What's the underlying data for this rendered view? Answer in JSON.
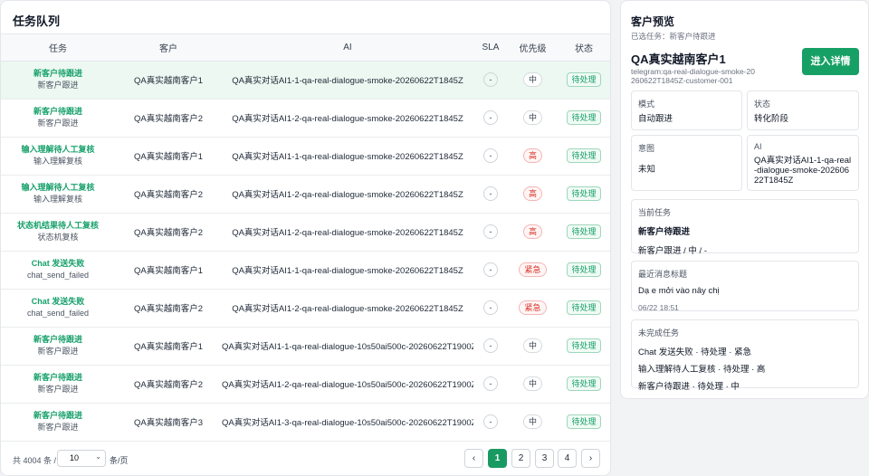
{
  "queue": {
    "title": "任务队列",
    "columns": [
      "任务",
      "客户",
      "AI",
      "SLA",
      "优先级",
      "状态"
    ],
    "rows": [
      {
        "task": "新客户待跟进",
        "sub": "新客户跟进",
        "customer": "QA真实越南客户1",
        "ai": "QA真实对话AI1-1-qa-real-dialogue-smoke-20260622T1845Z",
        "sla": "-",
        "priority": "中",
        "priority_level": "normal",
        "status": "待处理"
      },
      {
        "task": "新客户待跟进",
        "sub": "新客户跟进",
        "customer": "QA真实越南客户2",
        "ai": "QA真实对话AI1-2-qa-real-dialogue-smoke-20260622T1845Z",
        "sla": "-",
        "priority": "中",
        "priority_level": "normal",
        "status": "待处理"
      },
      {
        "task": "输入理解待人工复核",
        "sub": "输入理解复核",
        "customer": "QA真实越南客户1",
        "ai": "QA真实对话AI1-1-qa-real-dialogue-smoke-20260622T1845Z",
        "sla": "-",
        "priority": "高",
        "priority_level": "high",
        "status": "待处理"
      },
      {
        "task": "输入理解待人工复核",
        "sub": "输入理解复核",
        "customer": "QA真实越南客户2",
        "ai": "QA真实对话AI1-2-qa-real-dialogue-smoke-20260622T1845Z",
        "sla": "-",
        "priority": "高",
        "priority_level": "high",
        "status": "待处理"
      },
      {
        "task": "状态机结果待人工复核",
        "sub": "状态机复核",
        "customer": "QA真实越南客户2",
        "ai": "QA真实对话AI1-2-qa-real-dialogue-smoke-20260622T1845Z",
        "sla": "-",
        "priority": "高",
        "priority_level": "high",
        "status": "待处理"
      },
      {
        "task": "Chat 发送失败",
        "sub": "chat_send_failed",
        "customer": "QA真实越南客户1",
        "ai": "QA真实对话AI1-1-qa-real-dialogue-smoke-20260622T1845Z",
        "sla": "-",
        "priority": "紧急",
        "priority_level": "high",
        "status": "待处理"
      },
      {
        "task": "Chat 发送失败",
        "sub": "chat_send_failed",
        "customer": "QA真实越南客户2",
        "ai": "QA真实对话AI1-2-qa-real-dialogue-smoke-20260622T1845Z",
        "sla": "-",
        "priority": "紧急",
        "priority_level": "high",
        "status": "待处理"
      },
      {
        "task": "新客户待跟进",
        "sub": "新客户跟进",
        "customer": "QA真实越南客户1",
        "ai": "QA真实对话AI1-1-qa-real-dialogue-10s50ai500c-20260622T1900Z",
        "sla": "-",
        "priority": "中",
        "priority_level": "normal",
        "status": "待处理"
      },
      {
        "task": "新客户待跟进",
        "sub": "新客户跟进",
        "customer": "QA真实越南客户2",
        "ai": "QA真实对话AI1-2-qa-real-dialogue-10s50ai500c-20260622T1900Z",
        "sla": "-",
        "priority": "中",
        "priority_level": "normal",
        "status": "待处理"
      },
      {
        "task": "新客户待跟进",
        "sub": "新客户跟进",
        "customer": "QA真实越南客户3",
        "ai": "QA真实对话AI1-3-qa-real-dialogue-10s50ai500c-20260622T1900Z",
        "sla": "-",
        "priority": "中",
        "priority_level": "normal",
        "status": "待处理"
      }
    ]
  },
  "pager": {
    "total": "共 4004 条 /",
    "page_size": "10",
    "per_page_label": "条/页",
    "prev": "‹",
    "next": "›",
    "pages": [
      "1",
      "2",
      "3",
      "4"
    ],
    "current": "1"
  },
  "preview": {
    "title": "客户预览",
    "selected": "已选任务：新客户待跟进",
    "name": "QA真实越南客户1",
    "id": "telegram:qa-real-dialogue-smoke-20260622T1845Z-customer-001",
    "detail_button": "进入详情",
    "mode_label": "模式",
    "mode_value": "自动跟进",
    "state_label": "状态",
    "state_value": "转化阶段",
    "intent_label": "意图",
    "intent_value": "未知",
    "ai_label": "AI",
    "ai_value": "QA真实对话AI1-1-qa-real-dialogue-smoke-20260622T1845Z",
    "current_task_label": "当前任务",
    "current_task_name": "新客户待跟进",
    "current_task_detail": "新客户跟进 / 中 / -",
    "last_msg_label": "最近消息标题",
    "last_msg_text": "Dạ e mởi vào nây chị",
    "last_msg_time": "06/22 18:51",
    "open_tasks_label": "未完成任务",
    "open_tasks": [
      "Chat 发送失败 · 待处理 · 紧急",
      "输入理解待人工复核 · 待处理 · 高",
      "新客户待跟进 · 待处理 · 中"
    ]
  },
  "colors": {
    "accent": "#17a065",
    "danger": "#d93025"
  }
}
